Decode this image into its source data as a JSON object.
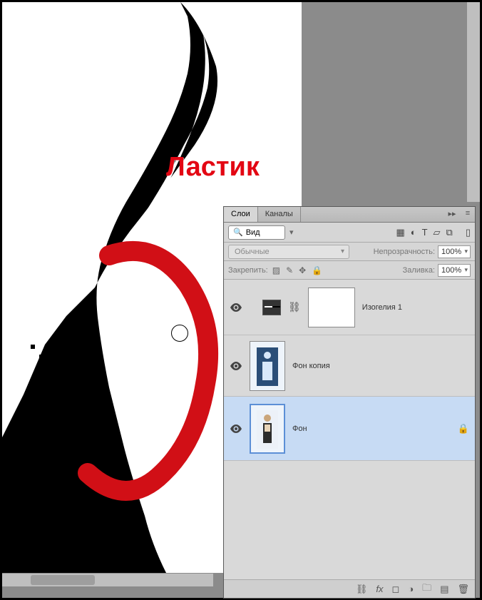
{
  "annotation": {
    "eraser_label": "Ластик"
  },
  "panel": {
    "tabs": {
      "layers": "Слои",
      "channels": "Каналы"
    },
    "search": {
      "value": "Вид"
    },
    "blend_mode": "Обычные",
    "opacity": {
      "label": "Непрозрачность:",
      "value": "100%"
    },
    "fill": {
      "label": "Заливка:",
      "value": "100%"
    },
    "lock_label": "Закрепить:",
    "layers": [
      {
        "name": "Изогелия 1"
      },
      {
        "name": "Фон копия"
      },
      {
        "name": "Фон"
      }
    ]
  }
}
